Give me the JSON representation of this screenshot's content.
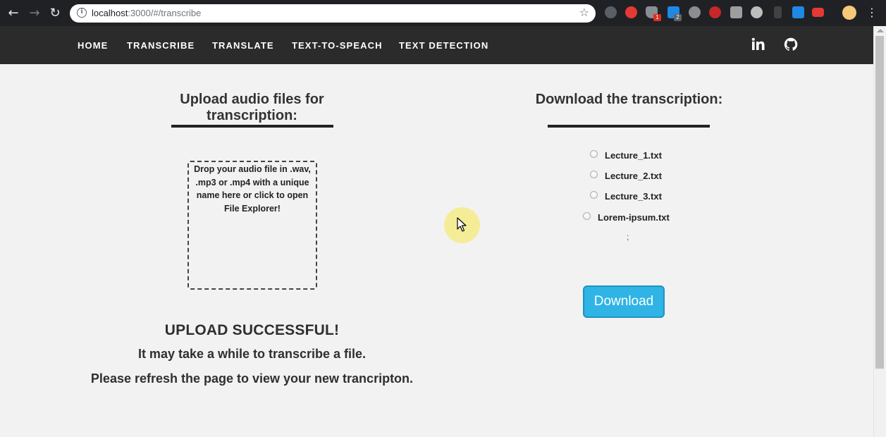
{
  "browser": {
    "url_host": "localhost",
    "url_path": ":3000/#/transcribe",
    "extension_badges": [
      "1",
      "2"
    ]
  },
  "nav": {
    "links": [
      "HOME",
      "TRANSCRIBE",
      "TRANSLATE",
      "TEXT-TO-SPEACH",
      "TEXT DETECTION"
    ],
    "linkedin_icon": "linkedin-icon",
    "github_icon": "github-icon"
  },
  "upload": {
    "heading": "Upload audio files for transcription:",
    "dropzone_text": "Drop your audio file in .wav, .mp3 or .mp4 with a unique name here or click to open File Explorer!",
    "status_title": "UPLOAD SUCCESSFUL!",
    "status_line1": "It may take a while to transcribe a file.",
    "status_line2": "Please refresh the page to view your new trancripton."
  },
  "download": {
    "heading": "Download the transcription:",
    "files": [
      "Lecture_1.txt",
      "Lecture_2.txt",
      "Lecture_3.txt",
      "Lorem-ipsum.txt"
    ],
    "separator": ";",
    "button_label": "Download"
  },
  "colors": {
    "nav_bg": "#2b2b2b",
    "page_bg": "#f3f2f2",
    "button_bg": "#2fb4e5"
  }
}
